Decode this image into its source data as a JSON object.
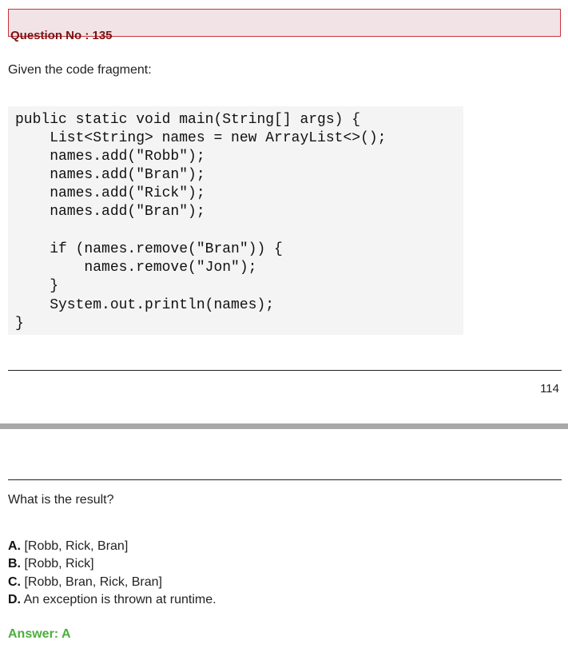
{
  "question_header": {
    "title": "Question No : 135"
  },
  "intro_text": "Given the code fragment:",
  "code": {
    "lines": [
      "public static void main(String[] args) {",
      "    List<String> names = new ArrayList<>();",
      "    names.add(\"Robb\");",
      "    names.add(\"Bran\");",
      "    names.add(\"Rick\");",
      "    names.add(\"Bran\");",
      "",
      "    if (names.remove(\"Bran\")) {",
      "        names.remove(\"Jon\");",
      "    }",
      "    System.out.println(names);",
      "}"
    ]
  },
  "page_number": "114",
  "question_text": "What is the result?",
  "options": [
    {
      "letter": "A.",
      "text": " [Robb, Rick, Bran]"
    },
    {
      "letter": "B.",
      "text": " [Robb, Rick]"
    },
    {
      "letter": "C.",
      "text": " [Robb, Bran, Rick, Bran]"
    },
    {
      "letter": "D.",
      "text": " An exception is thrown at runtime."
    }
  ],
  "answer": "Answer: A",
  "colors": {
    "header_border": "#c8323c",
    "header_background": "#f2e4e6",
    "header_text": "#7a1414",
    "answer_text": "#4cae3a",
    "code_background": "#f4f4f4",
    "page_break": "#a8a8a8"
  }
}
